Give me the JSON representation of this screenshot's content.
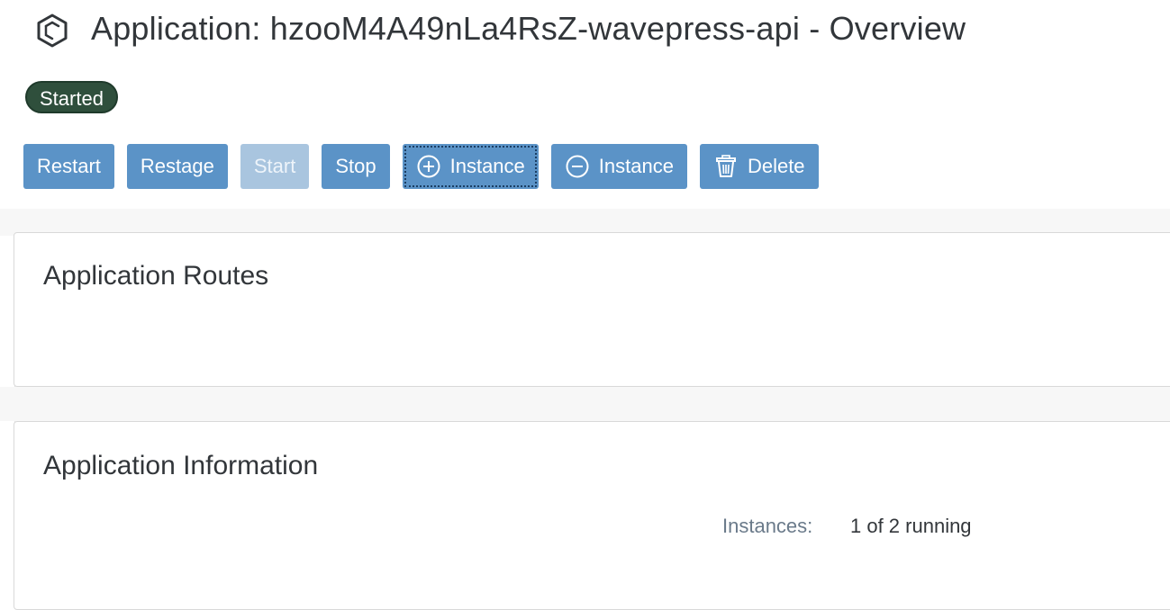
{
  "header": {
    "icon": "application-hexagon-icon",
    "title": "Application: hzooM4A49nLa4RsZ-wavepress-api - Overview",
    "status": "Started",
    "status_color": "#2f4f3c"
  },
  "toolbar": {
    "accent_color": "#5b93c7",
    "buttons": [
      {
        "label": "Restart",
        "enabled": true
      },
      {
        "label": "Restage",
        "enabled": true
      },
      {
        "label": "Start",
        "enabled": false
      },
      {
        "label": "Stop",
        "enabled": true
      },
      {
        "label": "Instance",
        "icon": "add-circle-icon",
        "enabled": true,
        "focused": true
      },
      {
        "label": "Instance",
        "icon": "remove-circle-icon",
        "enabled": true
      },
      {
        "label": "Delete",
        "icon": "trash-icon",
        "enabled": true
      }
    ]
  },
  "routes_panel": {
    "title": "Application Routes"
  },
  "info_panel": {
    "title": "Application Information",
    "instances_label": "Instances:",
    "instances_value": "1 of 2 running"
  }
}
